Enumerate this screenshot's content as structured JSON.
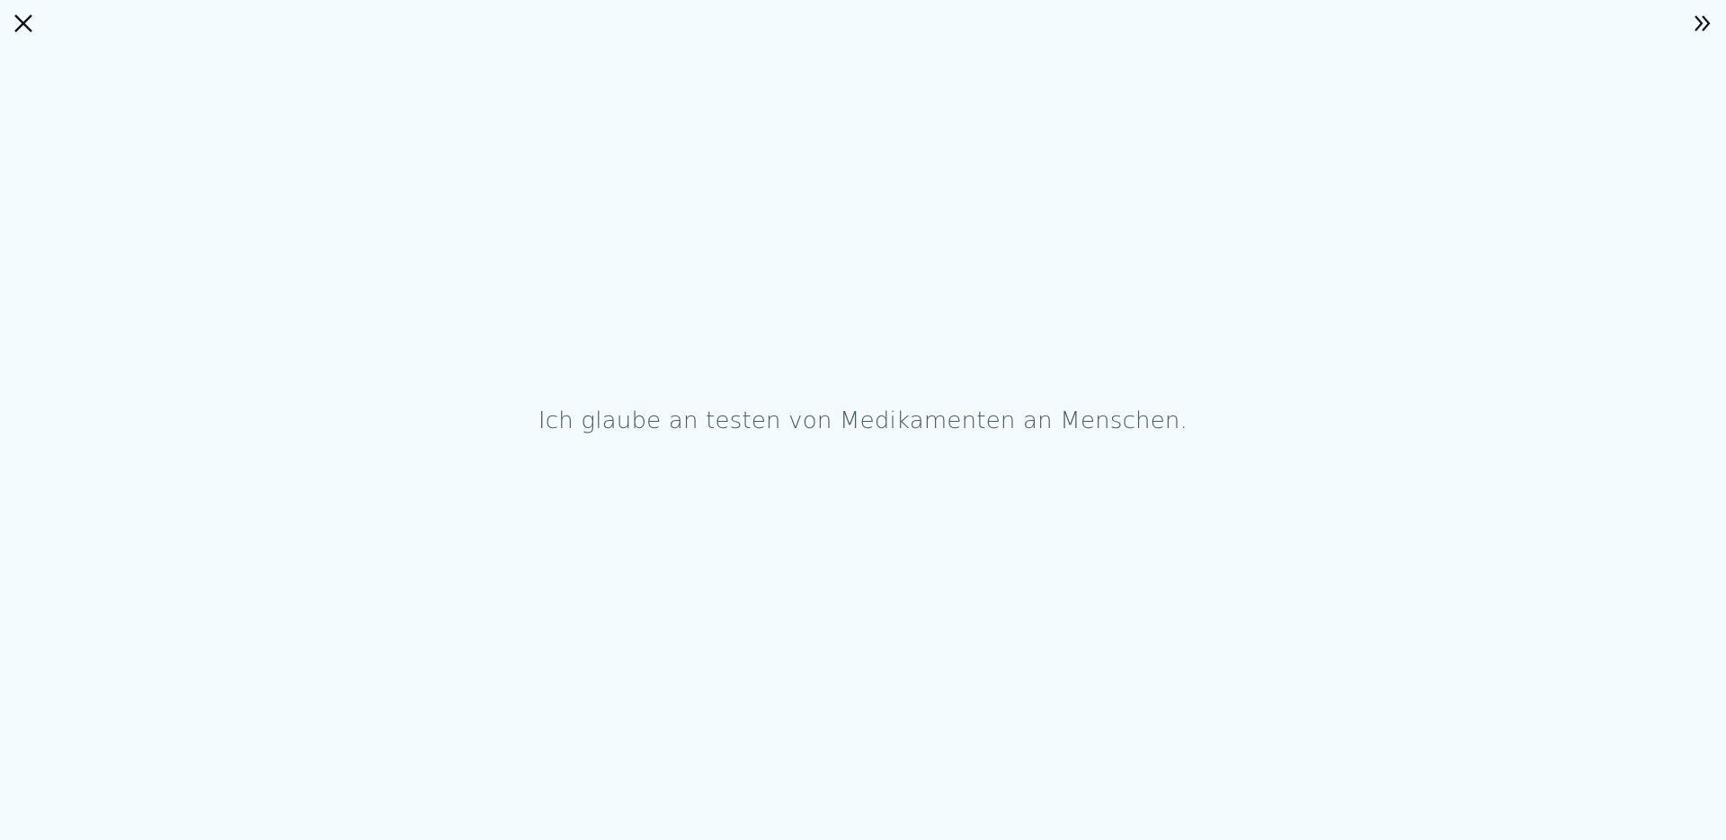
{
  "toolbar": {
    "close_icon": "close-icon",
    "next_icon": "double-chevron-right-icon"
  },
  "main": {
    "statement": "Ich glaube an testen von Medikamenten an Menschen."
  },
  "colors": {
    "background": "#f3fbfe",
    "text": "#4a5b63",
    "icon": "#111111"
  }
}
